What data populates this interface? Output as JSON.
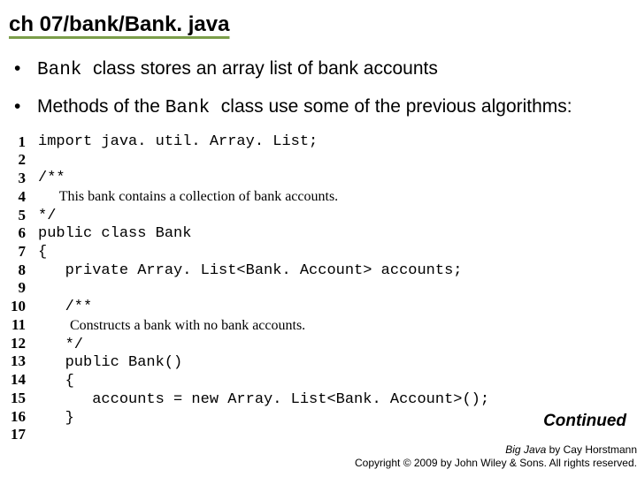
{
  "title": "ch 07/bank/Bank. java",
  "bullets": [
    {
      "prefix_code": "Bank ",
      "rest": " class stores an array list of bank accounts"
    },
    {
      "prefix_code": "",
      "rest": "Methods of the ",
      "mid_code": "Bank ",
      "tail": " class use some of the previous algorithms:"
    }
  ],
  "line_numbers": " 1\n 2\n 3\n 4\n 5\n 6\n 7\n 8\n 9\n10\n11\n12\n13\n14\n15\n16\n17",
  "code": {
    "l1": "import java. util. Array. List;",
    "l3": "/**",
    "l4": "      This bank contains a collection of bank accounts.",
    "l5": "*/",
    "l6": "public class Bank",
    "l7": "{",
    "l8": "   private Array. List<Bank. Account> accounts;",
    "l10": "   /**",
    "l11": "         Constructs a bank with no bank accounts.",
    "l12": "   */",
    "l13": "   public Bank()",
    "l14": "   {",
    "l15": "      accounts = new Array. List<Bank. Account>();",
    "l16": "   }"
  },
  "continued": "Continued",
  "footer": {
    "line1_book": "Big Java",
    "line1_rest": " by Cay Horstmann",
    "line2": "Copyright © 2009 by John Wiley & Sons. All rights reserved."
  }
}
